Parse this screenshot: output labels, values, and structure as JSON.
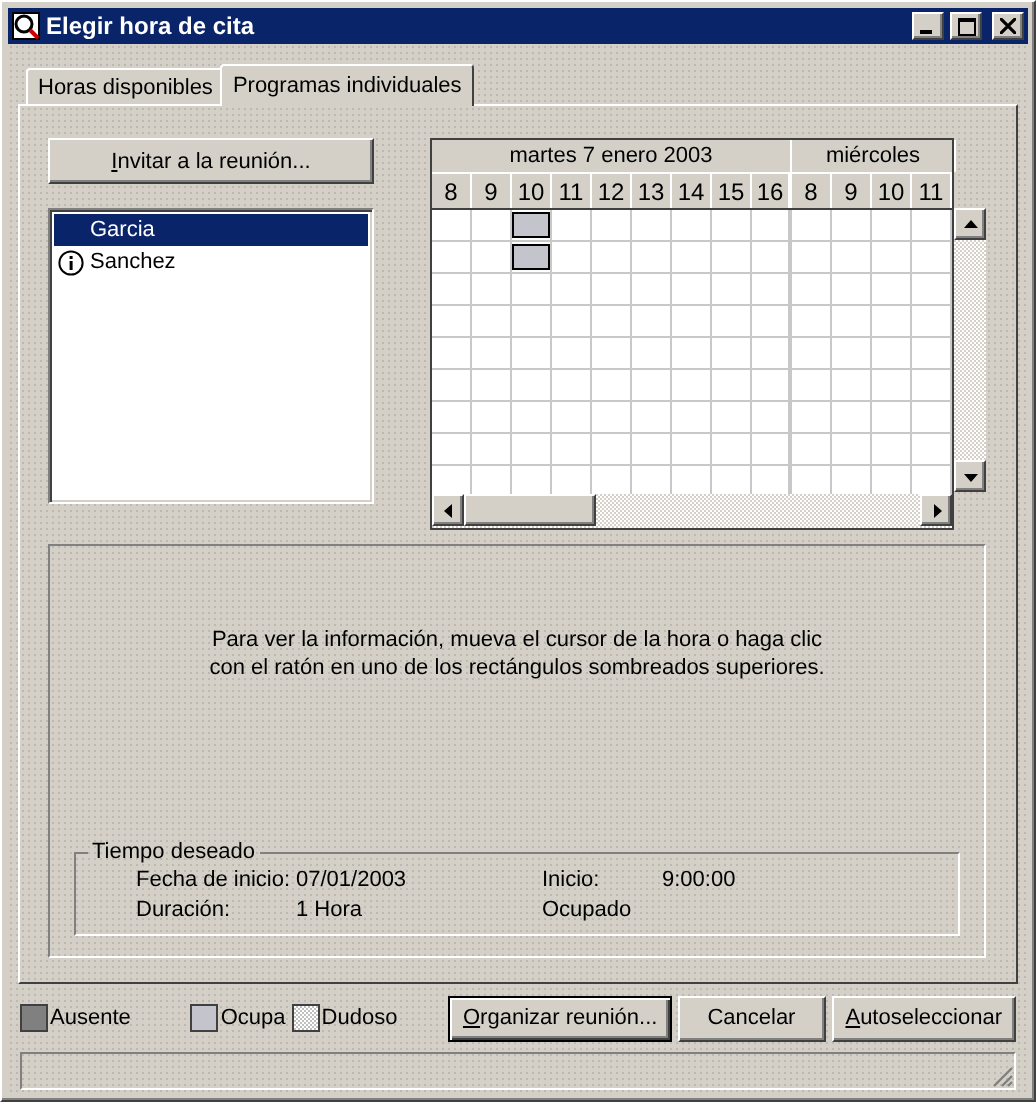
{
  "window": {
    "title": "Elegir hora de cita"
  },
  "tabs": [
    {
      "label": "Horas disponibles",
      "selected": false
    },
    {
      "label": "Programas individuales",
      "selected": true
    }
  ],
  "invite_button": {
    "label": "Invitar a la reunión...",
    "underline_first": true
  },
  "attendees": [
    {
      "name": "Garcia",
      "selected": true,
      "kind": "plain"
    },
    {
      "name": "Sanchez",
      "selected": false,
      "kind": "info"
    }
  ],
  "grid": {
    "days": [
      {
        "label": "martes 7 enero 2003",
        "hours": [
          "8",
          "9",
          "10",
          "11",
          "12",
          "13",
          "14",
          "15",
          "16"
        ]
      },
      {
        "label": "miércoles",
        "hours": [
          "8",
          "9",
          "10",
          "11"
        ]
      }
    ],
    "rows": [
      {
        "busy": [
          false,
          false,
          true,
          false,
          false,
          false,
          false,
          false,
          false,
          false,
          false,
          false,
          false
        ]
      },
      {
        "busy": [
          false,
          false,
          true,
          false,
          false,
          false,
          false,
          false,
          false,
          false,
          false,
          false,
          false
        ]
      },
      {
        "busy": [
          false,
          false,
          false,
          false,
          false,
          false,
          false,
          false,
          false,
          false,
          false,
          false,
          false
        ]
      },
      {
        "busy": [
          false,
          false,
          false,
          false,
          false,
          false,
          false,
          false,
          false,
          false,
          false,
          false,
          false
        ]
      },
      {
        "busy": [
          false,
          false,
          false,
          false,
          false,
          false,
          false,
          false,
          false,
          false,
          false,
          false,
          false
        ]
      },
      {
        "busy": [
          false,
          false,
          false,
          false,
          false,
          false,
          false,
          false,
          false,
          false,
          false,
          false,
          false
        ]
      },
      {
        "busy": [
          false,
          false,
          false,
          false,
          false,
          false,
          false,
          false,
          false,
          false,
          false,
          false,
          false
        ]
      },
      {
        "busy": [
          false,
          false,
          false,
          false,
          false,
          false,
          false,
          false,
          false,
          false,
          false,
          false,
          false
        ]
      },
      {
        "busy": [
          false,
          false,
          false,
          false,
          false,
          false,
          false,
          false,
          false,
          false,
          false,
          false,
          false
        ]
      }
    ]
  },
  "info": {
    "message": "Para ver la información, mueva el cursor de la hora o haga clic\ncon el ratón en uno de los rectángulos sombreados superiores.",
    "group_title": "Tiempo deseado",
    "rows": [
      [
        "Fecha de inicio:",
        "07/01/2003",
        "Inicio:",
        "9:00:00"
      ],
      [
        "Duración:",
        "1 Hora",
        "Ocupado"
      ]
    ]
  },
  "legend": [
    {
      "kind": "absent",
      "label": "Ausente"
    },
    {
      "kind": "busy",
      "label": "Ocupa"
    },
    {
      "kind": "tentative",
      "label": "Dudoso"
    }
  ],
  "buttons": [
    {
      "label": "Organizar reunión...",
      "default": true,
      "underline_first": true
    },
    {
      "label": "Cancelar",
      "default": false,
      "underline_first": false
    },
    {
      "label": "Autoseleccionar",
      "default": false,
      "underline_first": true
    }
  ]
}
